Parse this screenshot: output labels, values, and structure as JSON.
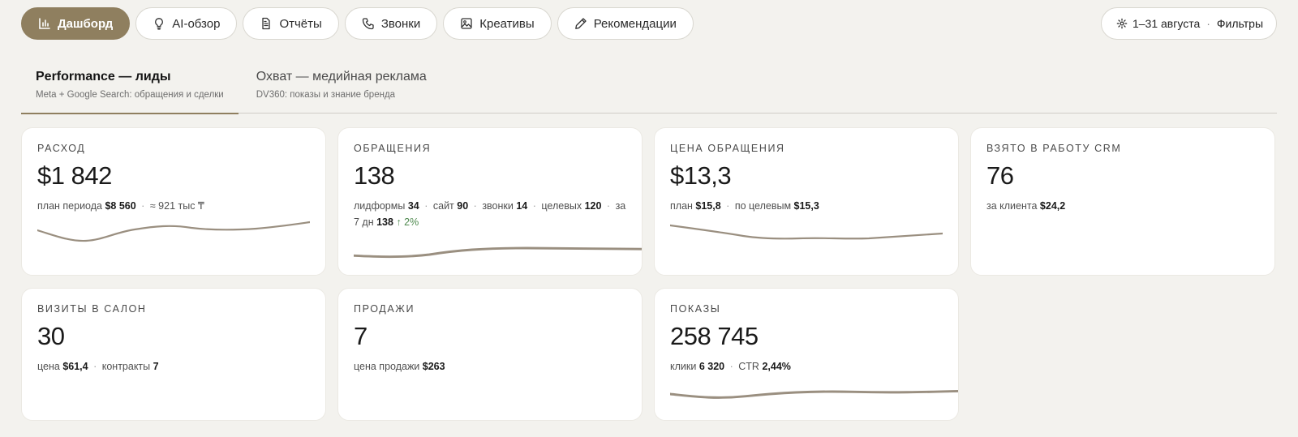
{
  "nav": {
    "dashboard": "Дашборд",
    "ai_overview": "AI-обзор",
    "reports": "Отчёты",
    "calls": "Звонки",
    "creatives": "Креативы",
    "recommendations": "Рекомендации"
  },
  "filter": {
    "period": "1–31 августа",
    "separator": "·",
    "filters_label": "Фильтры"
  },
  "tabs": [
    {
      "title": "Performance — лиды",
      "subtitle": "Meta + Google Search: обращения и сделки"
    },
    {
      "title": "Охват — медийная реклама",
      "subtitle": "DV360: показы и знание бренда"
    }
  ],
  "colors": {
    "accent": "#8f7f5f",
    "sparkline": "#9a8f80",
    "positive": "#4f8a4f",
    "background": "#f3f2ee"
  },
  "cards": {
    "spend": {
      "label": "Расход",
      "value": "$1 842",
      "plan_label": "план периода",
      "plan_value": "$8 560",
      "sep": "·",
      "extra": "≈ 921 тыс ₸"
    },
    "leads": {
      "label": "Обращения",
      "value": "138",
      "lf_label": "лидформы",
      "lf_value": "34",
      "site_label": "сайт",
      "site_value": "90",
      "calls_label": "звонки",
      "calls_value": "14",
      "target_label": "целевых",
      "target_value": "120",
      "week_label": "за 7 дн",
      "week_value": "138",
      "delta": "↑ 2%",
      "sep": "·"
    },
    "cpl": {
      "label": "Цена обращения",
      "value": "$13,3",
      "plan_label": "план",
      "plan_value": "$15,8",
      "target_label": "по целевым",
      "target_value": "$15,3",
      "sep": "·"
    },
    "crm": {
      "label": "Взято в работу CRM",
      "value": "76",
      "per_client_label": "за клиента",
      "per_client_value": "$24,2"
    },
    "visits": {
      "label": "Визиты в салон",
      "value": "30",
      "price_label": "цена",
      "price_value": "$61,4",
      "contracts_label": "контракты",
      "contracts_value": "7",
      "sep": "·"
    },
    "sales": {
      "label": "Продажи",
      "value": "7",
      "price_label": "цена продажи",
      "price_value": "$263"
    },
    "impressions": {
      "label": "Показы",
      "value": "258 745",
      "clicks_label": "клики",
      "clicks_value": "6 320",
      "ctr_label": "CTR",
      "ctr_value": "2,44%",
      "sep": "·"
    }
  }
}
